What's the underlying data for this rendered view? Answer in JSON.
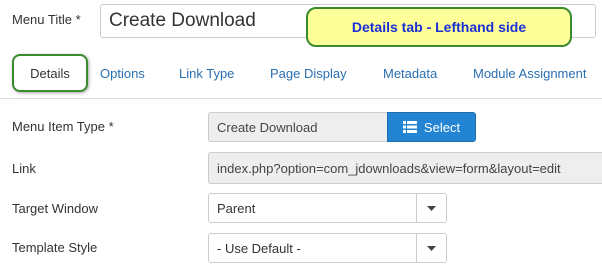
{
  "title": {
    "label": "Menu Title *",
    "value": "Create Download"
  },
  "callout": {
    "text": "Details tab - Lefthand side"
  },
  "tabs": [
    {
      "label": "Details",
      "active": true
    },
    {
      "label": "Options",
      "active": false
    },
    {
      "label": "Link Type",
      "active": false
    },
    {
      "label": "Page Display",
      "active": false
    },
    {
      "label": "Metadata",
      "active": false
    },
    {
      "label": "Module Assignment",
      "active": false
    }
  ],
  "fields": {
    "menu_item_type": {
      "label": "Menu Item Type *",
      "value": "Create Download",
      "button_label": "Select",
      "button_icon": "list-icon"
    },
    "link": {
      "label": "Link",
      "value": "index.php?option=com_jdownloads&view=form&layout=edit"
    },
    "target_window": {
      "label": "Target Window",
      "selected": "Parent"
    },
    "template_style": {
      "label": "Template Style",
      "selected": "- Use Default -"
    }
  },
  "colors": {
    "tab_link": "#2a6fb0",
    "select_button": "#2384d3",
    "callout_bg": "#ffff99",
    "callout_border": "#3a8a2e",
    "callout_text": "#1a2fd6"
  }
}
